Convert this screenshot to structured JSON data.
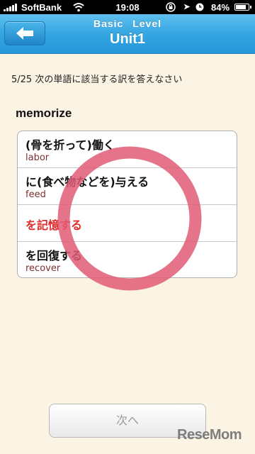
{
  "status_bar": {
    "carrier": "SoftBank",
    "time": "19:08",
    "battery": "84%",
    "battery_level": 0.84
  },
  "nav": {
    "back_icon": "left-arrow-icon",
    "subtitle": "Basic Level",
    "title": "Unit1"
  },
  "quiz": {
    "instruction": "5/25 次の単語に該当する訳を答えなさい",
    "word": "memorize",
    "choices": [
      {
        "jp": "(骨を折って)働く",
        "en": "labor"
      },
      {
        "jp": "に(食べ物などを)与える",
        "en": "feed"
      },
      {
        "jp": "を記憶する",
        "en": ""
      },
      {
        "jp": "を回復する",
        "en": "recover"
      }
    ],
    "correct_index": 2,
    "correct_color": "#e0292b",
    "mark_color": "#e05a74"
  },
  "next_label": "次へ",
  "watermark": "ReseMom"
}
